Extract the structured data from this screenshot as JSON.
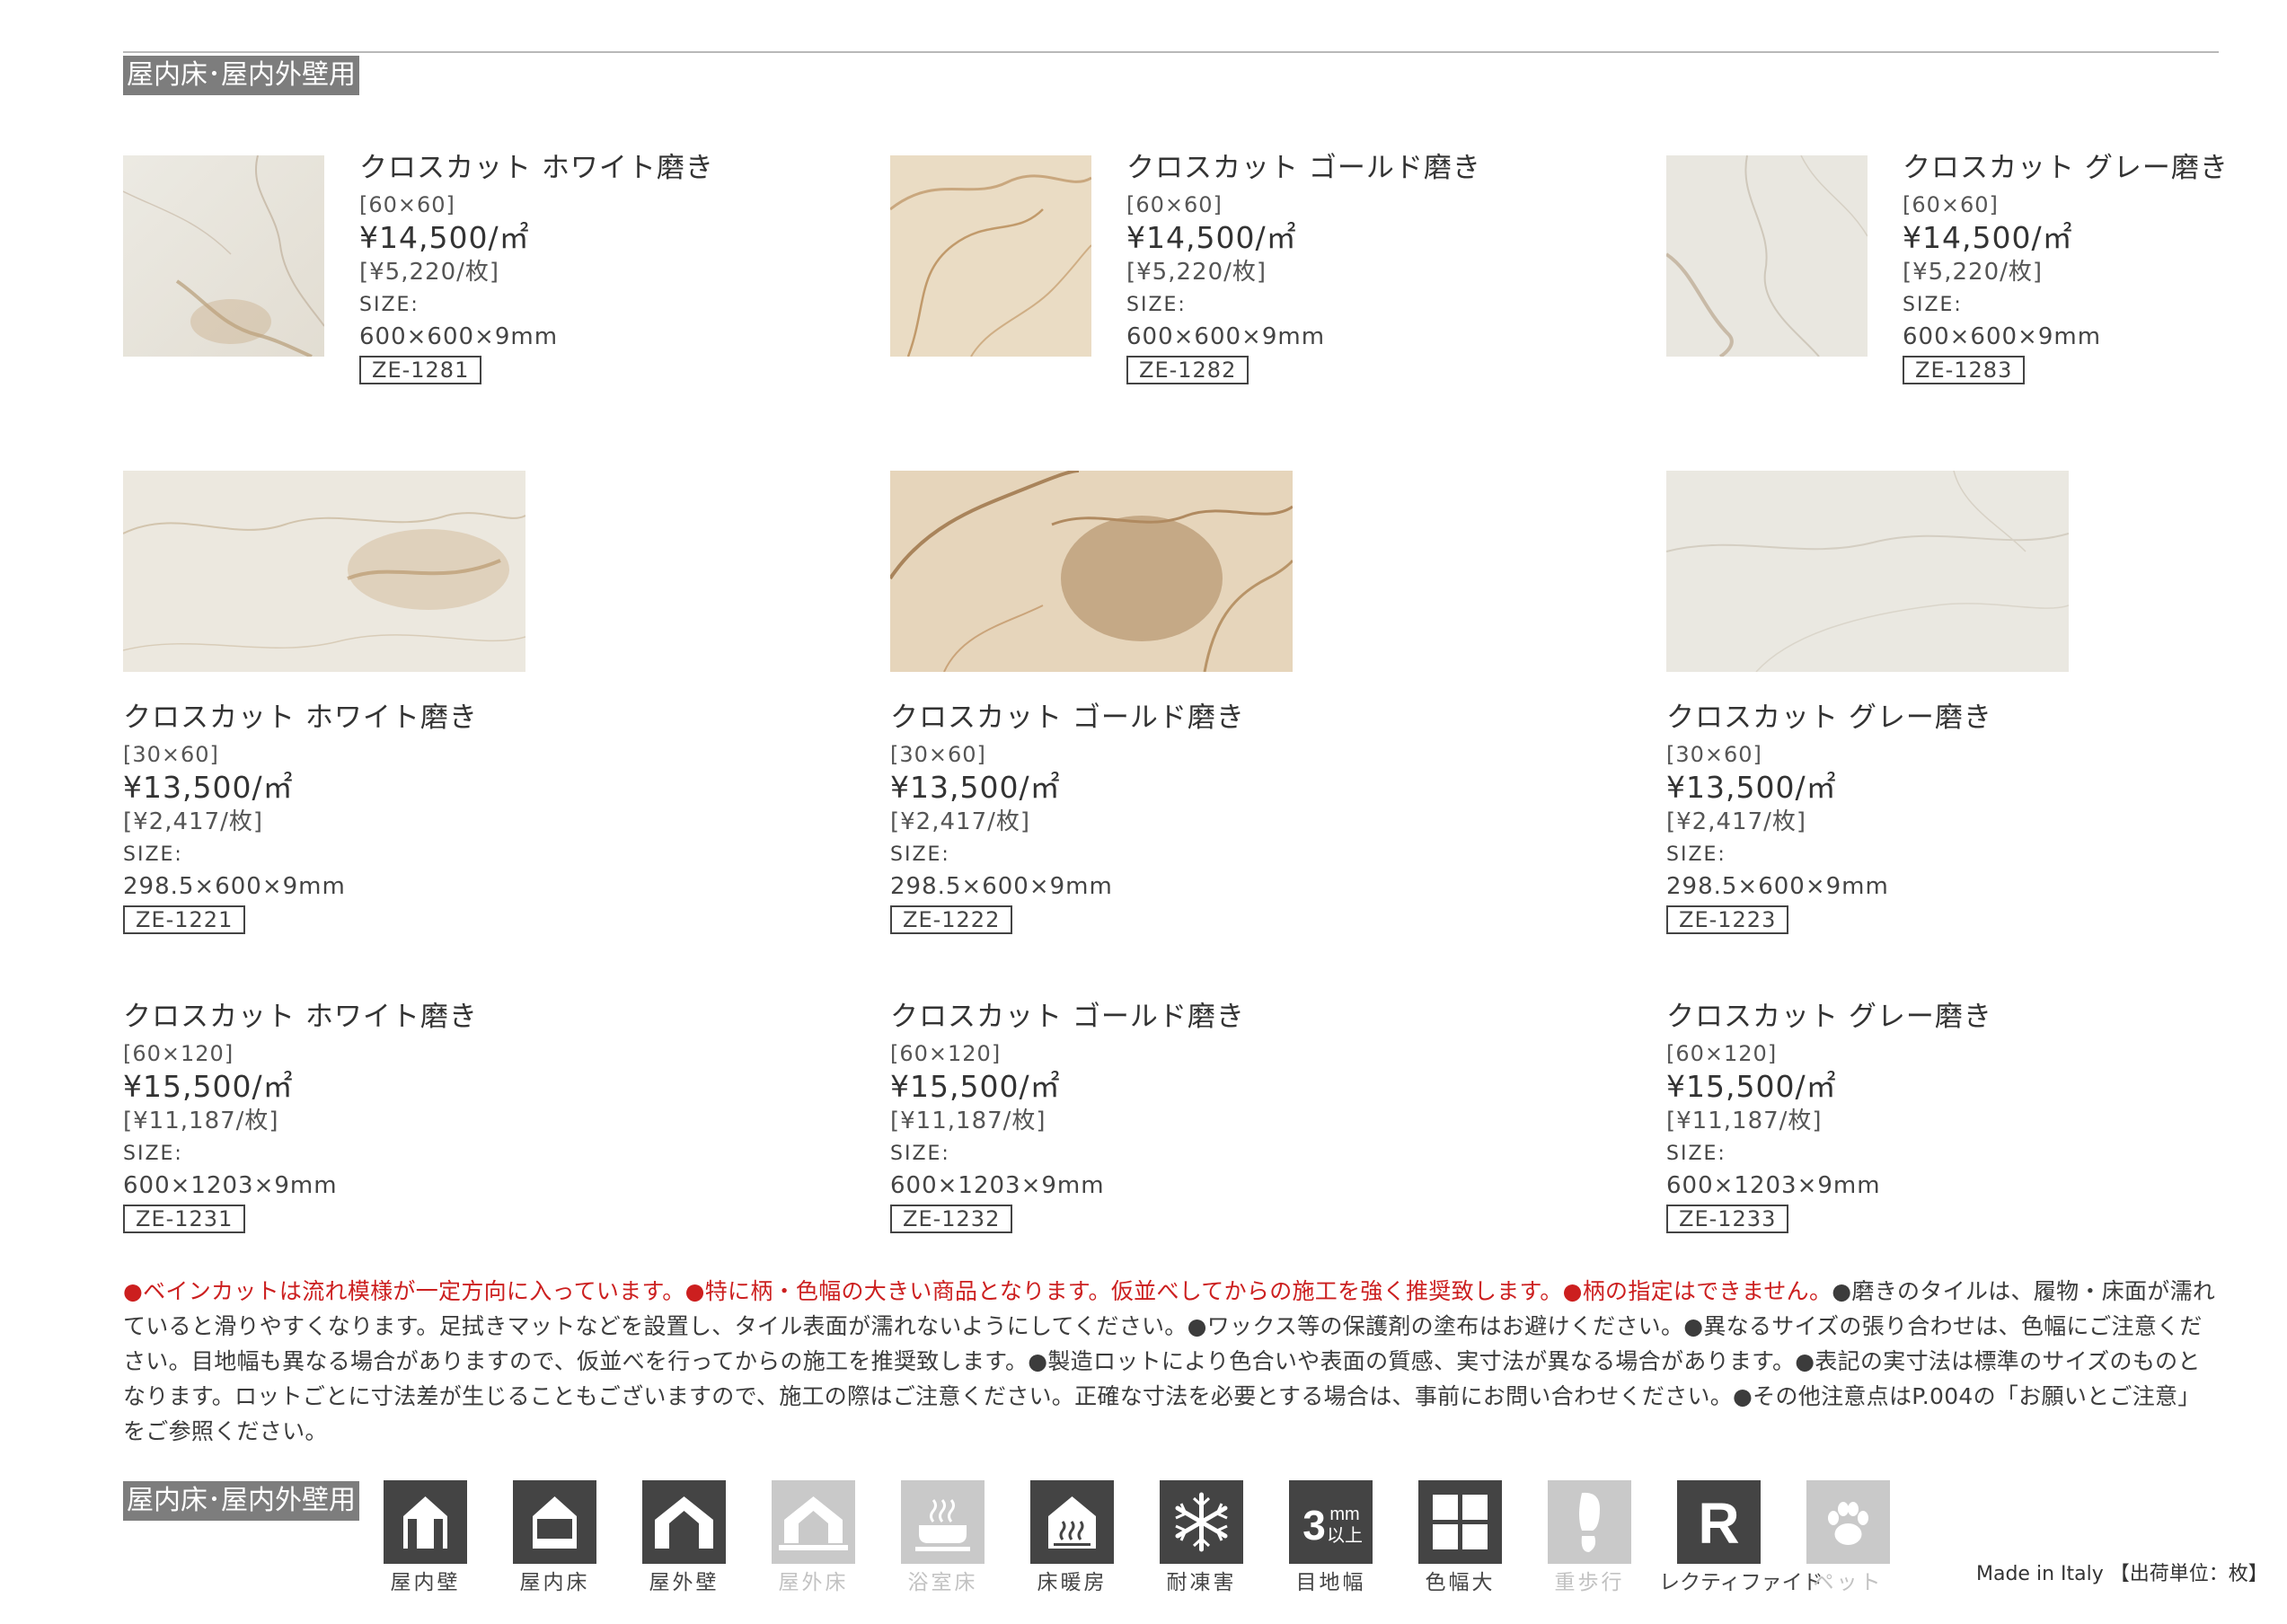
{
  "section_label": "屋内床･屋内外壁用",
  "products": [
    {
      "name": "クロスカット ホワイト磨き",
      "dims": "[60×60]",
      "price": "¥14,500/㎡",
      "per_piece": "[¥5,220/枚]",
      "size_label": "SIZE:",
      "size": "600×600×9mm",
      "code": "ZE-1281",
      "tone": "white"
    },
    {
      "name": "クロスカット ゴールド磨き",
      "dims": "[60×60]",
      "price": "¥14,500/㎡",
      "per_piece": "[¥5,220/枚]",
      "size_label": "SIZE:",
      "size": "600×600×9mm",
      "code": "ZE-1282",
      "tone": "gold"
    },
    {
      "name": "クロスカット グレー磨き",
      "dims": "[60×60]",
      "price": "¥14,500/㎡",
      "per_piece": "[¥5,220/枚]",
      "size_label": "SIZE:",
      "size": "600×600×9mm",
      "code": "ZE-1283",
      "tone": "grey"
    },
    {
      "name": "クロスカット ホワイト磨き",
      "dims": "[30×60]",
      "price": "¥13,500/㎡",
      "per_piece": "[¥2,417/枚]",
      "size_label": "SIZE:",
      "size": "298.5×600×9mm",
      "code": "ZE-1221",
      "tone": "white"
    },
    {
      "name": "クロスカット ゴールド磨き",
      "dims": "[30×60]",
      "price": "¥13,500/㎡",
      "per_piece": "[¥2,417/枚]",
      "size_label": "SIZE:",
      "size": "298.5×600×9mm",
      "code": "ZE-1222",
      "tone": "gold"
    },
    {
      "name": "クロスカット グレー磨き",
      "dims": "[30×60]",
      "price": "¥13,500/㎡",
      "per_piece": "[¥2,417/枚]",
      "size_label": "SIZE:",
      "size": "298.5×600×9mm",
      "code": "ZE-1223",
      "tone": "grey"
    },
    {
      "name": "クロスカット ホワイト磨き",
      "dims": "[60×120]",
      "price": "¥15,500/㎡",
      "per_piece": "[¥11,187/枚]",
      "size_label": "SIZE:",
      "size": "600×1203×9mm",
      "code": "ZE-1231",
      "tone": "white"
    },
    {
      "name": "クロスカット ゴールド磨き",
      "dims": "[60×120]",
      "price": "¥15,500/㎡",
      "per_piece": "[¥11,187/枚]",
      "size_label": "SIZE:",
      "size": "600×1203×9mm",
      "code": "ZE-1232",
      "tone": "gold"
    },
    {
      "name": "クロスカット グレー磨き",
      "dims": "[60×120]",
      "price": "¥15,500/㎡",
      "per_piece": "[¥11,187/枚]",
      "size_label": "SIZE:",
      "size": "600×1203×9mm",
      "code": "ZE-1233",
      "tone": "grey"
    }
  ],
  "notes": {
    "red_1": "●ベインカットは流れ模様が一定方向に入っています。",
    "red_2": "●特に柄・色幅の大きい商品となります。仮並べしてからの施工を強く推奨致します。",
    "red_3": "●柄の指定はできません。",
    "body": "●磨きのタイルは、履物・床面が濡れていると滑りやすくなります。足拭きマットなどを設置し、タイル表面が濡れないようにしてください。●ワックス等の保護剤の塗布はお避けください。●異なるサイズの張り合わせは、色幅にご注意ください。目地幅も異なる場合がありますので、仮並べを行ってからの施工を推奨致します。●製造ロットにより色合いや表面の質感、実寸法が異なる場合があります。●表記の実寸法は標準のサイズのものとなります。ロットごとに寸法差が生じることもございますので、施工の際はご注意ください。正確な寸法を必要とする場合は、事前にお問い合わせください。●その他注意点はP.004の「お願いとご注意」をご参照ください。"
  },
  "footer_label": "屋内床･屋内外壁用",
  "usage_icons": [
    {
      "label": "屋内壁",
      "icon": "indoor-wall-icon",
      "active": true
    },
    {
      "label": "屋内床",
      "icon": "indoor-floor-icon",
      "active": true
    },
    {
      "label": "屋外壁",
      "icon": "outdoor-wall-icon",
      "active": true
    },
    {
      "label": "屋外床",
      "icon": "outdoor-floor-icon",
      "active": false
    },
    {
      "label": "浴室床",
      "icon": "bathroom-floor-icon",
      "active": false
    },
    {
      "label": "床暖房",
      "icon": "floor-heating-icon",
      "active": true
    },
    {
      "label": "耐凍害",
      "icon": "frost-resistance-icon",
      "active": true
    },
    {
      "label": "目地幅",
      "icon": "joint-width-icon",
      "active": true,
      "badge_num": "3",
      "badge_unit": "mm",
      "badge_sub": "以上"
    },
    {
      "label": "色幅大",
      "icon": "color-variation-icon",
      "active": true
    },
    {
      "label": "重歩行",
      "icon": "heavy-traffic-icon",
      "active": false
    },
    {
      "label": "レクティファイド",
      "icon": "rectified-icon",
      "active": true,
      "badge_letter": "R"
    },
    {
      "label": "ペット",
      "icon": "pet-icon",
      "active": false
    }
  ],
  "made_in": "Made in Italy 【出荷単位：枚】",
  "colors": {
    "red": "#cc1f1f",
    "icon_active": "#444444",
    "icon_inactive": "#c9c9c9",
    "label_bg": "#7d7d7d"
  }
}
